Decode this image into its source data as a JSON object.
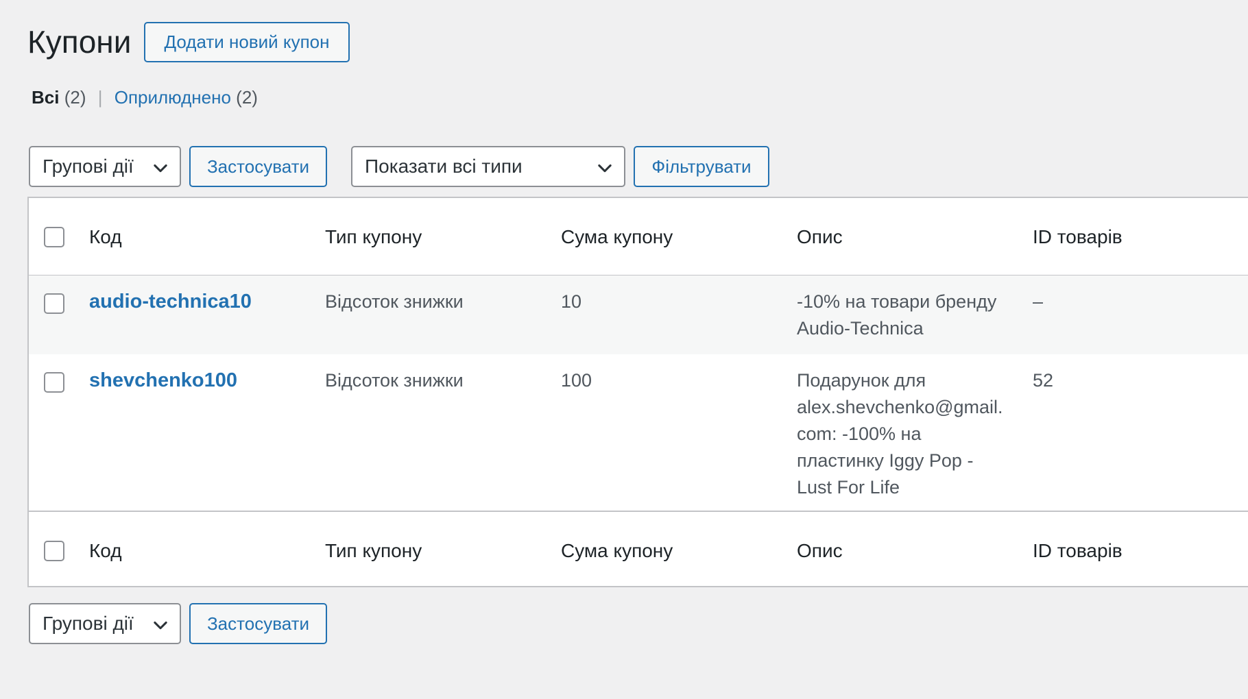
{
  "page": {
    "title": "Купони",
    "add_new_label": "Додати новий купон"
  },
  "views": {
    "all_label": "Всі",
    "all_count": "(2)",
    "separator": "|",
    "published_label": "Оприлюднено",
    "published_count": "(2)"
  },
  "toolbar_top": {
    "bulk_actions": "Групові дії",
    "apply": "Застосувати",
    "type_filter": "Показати всі типи",
    "filter": "Фільтрувати"
  },
  "toolbar_bottom": {
    "bulk_actions": "Групові дії",
    "apply": "Застосувати"
  },
  "table": {
    "columns": {
      "code": "Код",
      "type": "Тип купону",
      "amount": "Сума купону",
      "description": "Опис",
      "product_ids": "ID товарів"
    },
    "rows": [
      {
        "code": "audio-technica10",
        "type": "Відсоток знижки",
        "amount": "10",
        "description_lines": [
          "-10% на товари бренду",
          "Audio-Technica"
        ],
        "product_ids": "–"
      },
      {
        "code": "shevchenko100",
        "type": "Відсоток знижки",
        "amount": "100",
        "description_lines": [
          "Подарунок для",
          "alex.shevchenko@gmail.",
          "com: -100% на",
          "пластинку Iggy Pop -",
          "Lust For Life"
        ],
        "product_ids": "52"
      }
    ]
  },
  "icons": {
    "dropdown": "chevron-down-icon"
  },
  "colors": {
    "accent": "#2271b1",
    "background": "#f0f0f1",
    "border": "#c3c4c7"
  }
}
